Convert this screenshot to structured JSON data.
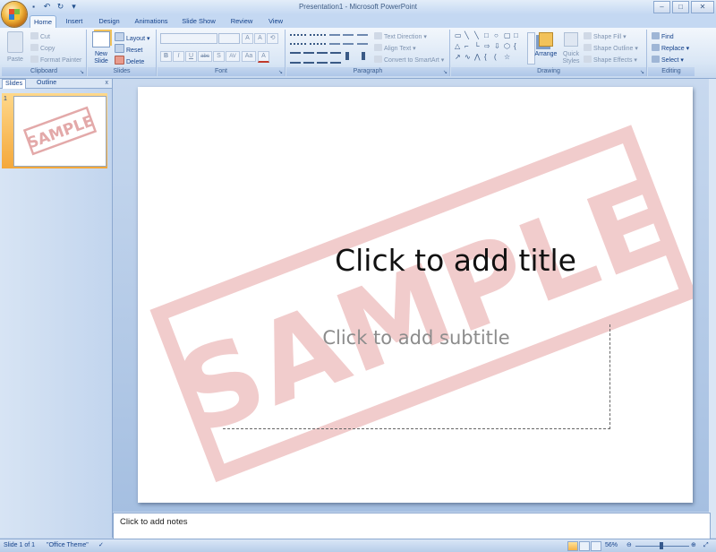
{
  "window": {
    "title": "Presentation1 - Microsoft PowerPoint",
    "controls": [
      "–",
      "□",
      "✕"
    ]
  },
  "qat": {
    "save": "💾",
    "undo": "↶",
    "redo": "↻",
    "customize": "▾"
  },
  "tabs": [
    "Home",
    "Insert",
    "Design",
    "Animations",
    "Slide Show",
    "Review",
    "View"
  ],
  "ribbon": {
    "clipboard": {
      "label": "Clipboard",
      "paste": "Paste",
      "cut": "Cut",
      "copy": "Copy",
      "format_painter": "Format Painter"
    },
    "slides": {
      "label": "Slides",
      "new_slide": "New Slide",
      "layout": "Layout",
      "reset": "Reset",
      "delete": "Delete"
    },
    "font": {
      "label": "Font",
      "bold": "B",
      "italic": "I",
      "underline": "U",
      "strike": "abc",
      "shadow": "S",
      "spacing": "AV",
      "case": "Aa",
      "grow": "A",
      "shrink": "A",
      "clear": "⟲",
      "color": "A"
    },
    "paragraph": {
      "label": "Paragraph",
      "text_direction": "Text Direction",
      "align_text": "Align Text",
      "smartart": "Convert to SmartArt"
    },
    "drawing": {
      "label": "Drawing",
      "arrange": "Arrange",
      "quick_styles": "Quick Styles",
      "shape_fill": "Shape Fill",
      "shape_outline": "Shape Outline",
      "shape_effects": "Shape Effects"
    },
    "editing": {
      "label": "Editing",
      "find": "Find",
      "replace": "Replace",
      "select": "Select"
    }
  },
  "pane": {
    "tab_slides": "Slides",
    "tab_outline": "Outline",
    "close": "x",
    "slide_number": "1"
  },
  "slide": {
    "title_placeholder": "Click to add title",
    "subtitle_placeholder": "Click to add subtitle",
    "watermark": "SAMPLE"
  },
  "thumbnail": {
    "watermark": "SAMPLE"
  },
  "notes": {
    "placeholder": "Click to add notes"
  },
  "status": {
    "slide": "Slide 1 of 1",
    "theme": "\"Office Theme\"",
    "zoom": "56%"
  },
  "colors": {
    "accent": "#15428b",
    "ribbon_bg": "#dbe7f6",
    "watermark": "#e3a9a9",
    "selection": "#f4a83b"
  }
}
